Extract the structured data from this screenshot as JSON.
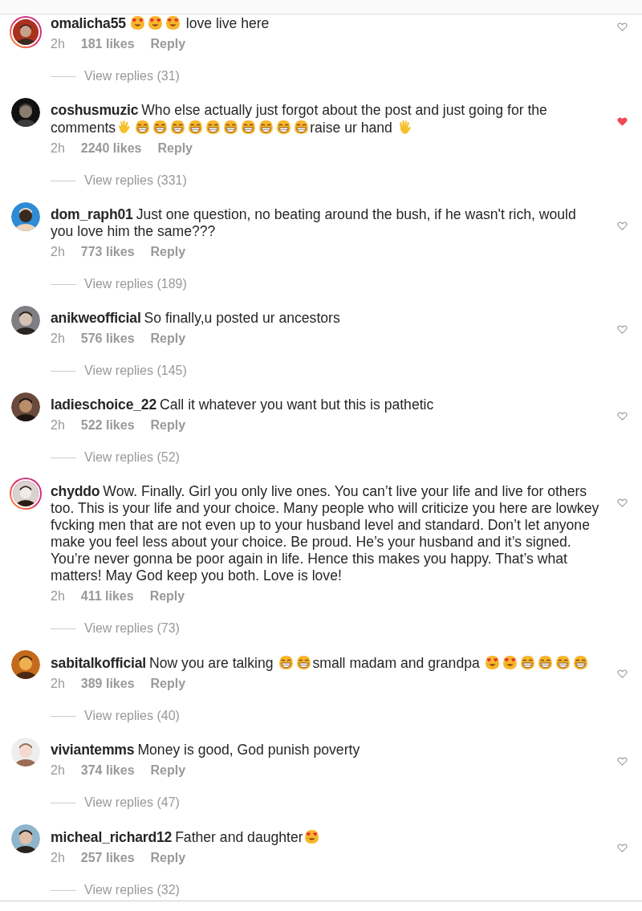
{
  "comments": [
    {
      "username": "omalicha55",
      "story": true,
      "liked": false,
      "time": "2h",
      "likes": "181 likes",
      "reply": "Reply",
      "view_replies": "View replies (31)",
      "parts": [
        {
          "kind": "heart_eyes"
        },
        {
          "kind": "heart_eyes"
        },
        {
          "kind": "heart_eyes"
        },
        {
          "kind": "text",
          "text": " love live here"
        }
      ]
    },
    {
      "username": "coshusmuzic",
      "story": false,
      "liked": true,
      "time": "2h",
      "likes": "2240 likes",
      "reply": "Reply",
      "view_replies": "View replies (331)",
      "parts": [
        {
          "kind": "text",
          "text": "Who else actually just forgot about the post and just going for the comments"
        },
        {
          "kind": "wave"
        },
        {
          "kind": "grin"
        },
        {
          "kind": "grin"
        },
        {
          "kind": "grin"
        },
        {
          "kind": "grin"
        },
        {
          "kind": "grin"
        },
        {
          "kind": "grin"
        },
        {
          "kind": "grin"
        },
        {
          "kind": "grin"
        },
        {
          "kind": "grin"
        },
        {
          "kind": "grin"
        },
        {
          "kind": "text",
          "text": "raise ur hand "
        },
        {
          "kind": "hand"
        }
      ]
    },
    {
      "username": "dom_raph01",
      "story": false,
      "liked": false,
      "time": "2h",
      "likes": "773 likes",
      "reply": "Reply",
      "view_replies": "View replies (189)",
      "parts": [
        {
          "kind": "text",
          "text": "Just one question, no beating around the bush, if he wasn't rich, would you love him the same???"
        }
      ]
    },
    {
      "username": "anikweofficial",
      "story": false,
      "liked": false,
      "time": "2h",
      "likes": "576 likes",
      "reply": "Reply",
      "view_replies": "View replies (145)",
      "parts": [
        {
          "kind": "text",
          "text": "So finally,u posted ur ancestors"
        }
      ]
    },
    {
      "username": "ladieschoice_22",
      "story": false,
      "liked": false,
      "time": "2h",
      "likes": "522 likes",
      "reply": "Reply",
      "view_replies": "View replies (52)",
      "parts": [
        {
          "kind": "text",
          "text": "Call it whatever you want but this is pathetic"
        }
      ]
    },
    {
      "username": "chyddo",
      "story": true,
      "liked": false,
      "time": "2h",
      "likes": "411 likes",
      "reply": "Reply",
      "view_replies": "View replies (73)",
      "parts": [
        {
          "kind": "text",
          "text": "Wow. Finally. Girl you only live ones. You can’t live your life and live for others too. This is your life and your choice. Many people who will criticize you here are lowkey fvcking men that are not even up to your husband level and standard. Don’t let anyone make you feel less about your choice. Be proud. He’s your husband and it’s signed. You’re never gonna be poor again in life. Hence this makes you happy. That’s what matters! May God keep you both. Love is love!"
        }
      ]
    },
    {
      "username": "sabitalkofficial",
      "story": false,
      "liked": false,
      "time": "2h",
      "likes": "389 likes",
      "reply": "Reply",
      "view_replies": "View replies (40)",
      "parts": [
        {
          "kind": "text",
          "text": "Now you are talking "
        },
        {
          "kind": "grin"
        },
        {
          "kind": "grin"
        },
        {
          "kind": "text",
          "text": "small madam and grandpa "
        },
        {
          "kind": "heart_eyes"
        },
        {
          "kind": "heart_eyes"
        },
        {
          "kind": "grin"
        },
        {
          "kind": "grin"
        },
        {
          "kind": "grin"
        },
        {
          "kind": "grin"
        }
      ]
    },
    {
      "username": "viviantemms",
      "story": false,
      "liked": false,
      "time": "2h",
      "likes": "374 likes",
      "reply": "Reply",
      "view_replies": "View replies (47)",
      "parts": [
        {
          "kind": "text",
          "text": "Money is good, God punish poverty"
        }
      ]
    },
    {
      "username": "micheal_richard12",
      "story": false,
      "liked": false,
      "time": "2h",
      "likes": "257 likes",
      "reply": "Reply",
      "view_replies": "View replies (32)",
      "parts": [
        {
          "kind": "text",
          "text": "Father and daughter"
        },
        {
          "kind": "heart_eyes"
        }
      ]
    }
  ]
}
